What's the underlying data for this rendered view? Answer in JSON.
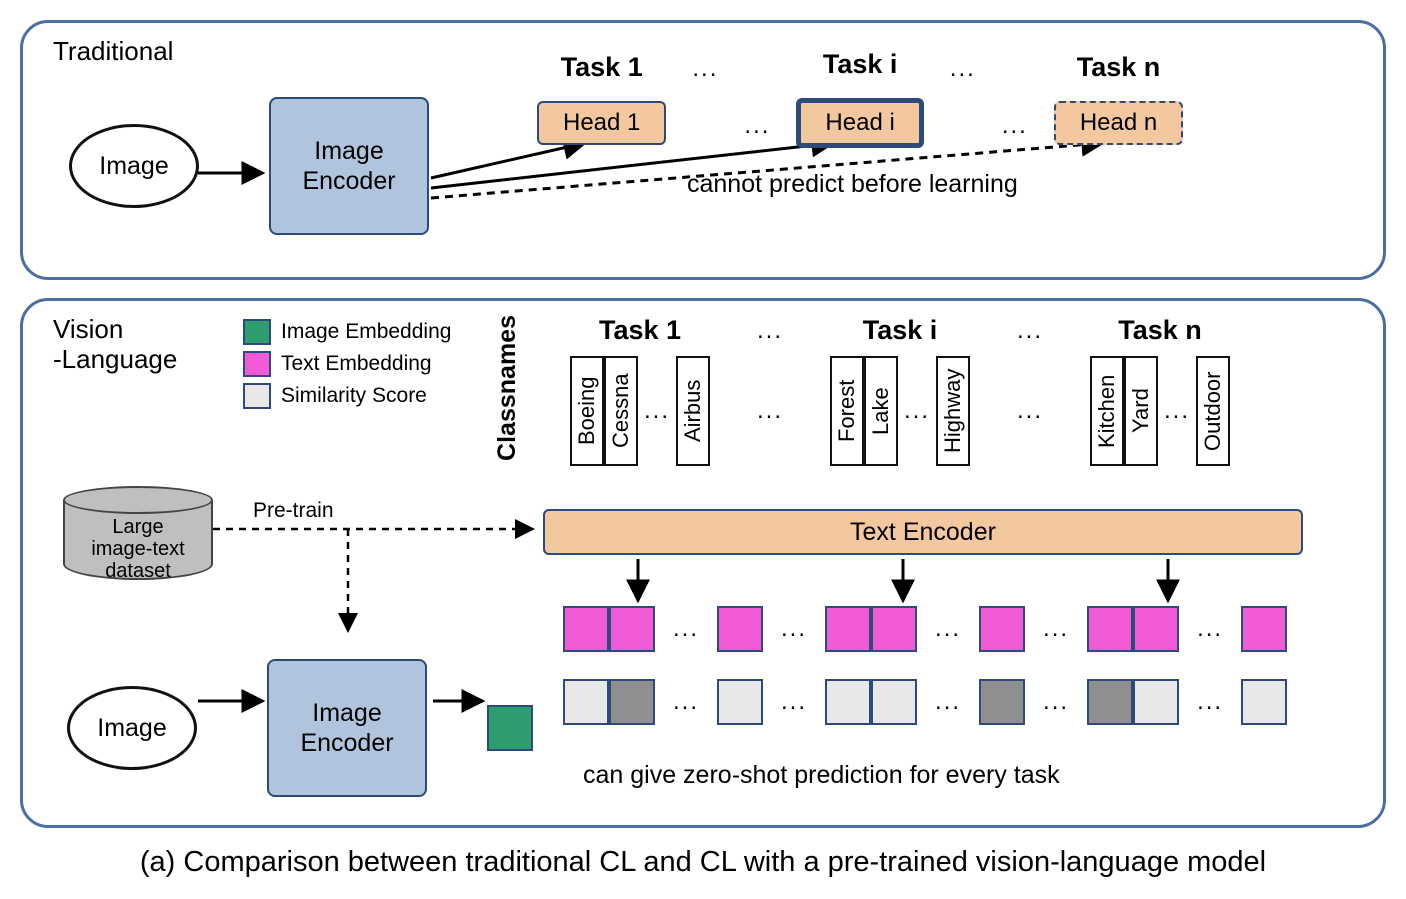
{
  "caption": "(a) Comparison between traditional CL and CL with a pre-trained vision-language model",
  "traditional": {
    "title": "Traditional",
    "image": "Image",
    "encoder": "Image\nEncoder",
    "tasks": {
      "t1": "Task 1",
      "ti": "Task i",
      "tn": "Task n"
    },
    "heads": {
      "h1": "Head 1",
      "hi": "Head i",
      "hn": "Head n"
    },
    "note": "cannot predict before learning",
    "dots": "..."
  },
  "vl": {
    "title": "Vision\n-Language",
    "legend": {
      "img_emb": "Image Embedding",
      "txt_emb": "Text Embedding",
      "sim": "Similarity Score"
    },
    "db": "Large\nimage-text\ndataset",
    "pretrain": "Pre-train",
    "image": "Image",
    "encoder": "Image\nEncoder",
    "text_encoder": "Text Encoder",
    "classnames_title": "Classnames",
    "tasks": {
      "t1": "Task 1",
      "ti": "Task i",
      "tn": "Task n"
    },
    "classes": {
      "t1": {
        "a": "Boeing",
        "b": "Cessna",
        "c": "Airbus"
      },
      "ti": {
        "a": "Forest",
        "b": "Lake",
        "c": "Highway"
      },
      "tn": {
        "a": "Kitchen",
        "b": "Yard",
        "c": "Outdoor"
      }
    },
    "note": "can give zero-shot prediction for every task",
    "dots": "..."
  }
}
